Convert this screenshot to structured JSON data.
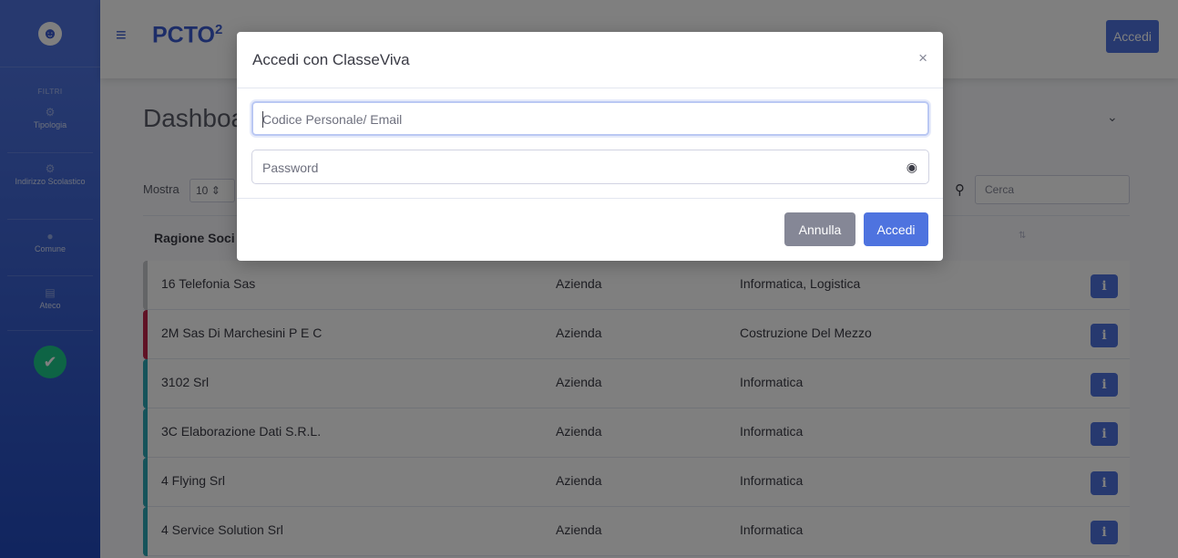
{
  "sidebar": {
    "brand_icon": "winking-face",
    "heading": "FILTRI",
    "items": [
      {
        "label": "Tipologia",
        "icon": "gear-icon"
      },
      {
        "label": "Indirizzo Scolastico",
        "icon": "gear-icon"
      },
      {
        "label": "Comune",
        "icon": "map-marker-icon"
      },
      {
        "label": "Ateco",
        "icon": "id-card-icon"
      }
    ],
    "apply_icon": "check-icon"
  },
  "topbar": {
    "menu_icon": "hamburger-icon",
    "logo_text": "PCTO",
    "logo_sup": "2",
    "login_button": "Accedi"
  },
  "main": {
    "title": "Dashboa",
    "show_label": "Mostra",
    "show_value": "10",
    "search_placeholder": "Cerca",
    "column_header": "Ragione Soci",
    "rows": [
      {
        "name": "16 Telefonia Sas",
        "type": "Azienda",
        "sector": "Informatica, Logistica",
        "color": "#c7c8cc"
      },
      {
        "name": "2M Sas Di Marchesini P E C",
        "type": "Azienda",
        "sector": "Costruzione Del Mezzo",
        "color": "#c0244a"
      },
      {
        "name": "3102 Srl",
        "type": "Azienda",
        "sector": "Informatica",
        "color": "#2ba7b5"
      },
      {
        "name": "3C Elaborazione Dati S.R.L.",
        "type": "Azienda",
        "sector": "Informatica",
        "color": "#2ba7b5"
      },
      {
        "name": "4 Flying Srl",
        "type": "Azienda",
        "sector": "Informatica",
        "color": "#2ba7b5"
      },
      {
        "name": "4 Service Solution Srl",
        "type": "Azienda",
        "sector": "Informatica",
        "color": "#2ba7b5"
      }
    ]
  },
  "modal": {
    "title": "Accedi con ClasseViva",
    "close": "×",
    "code_placeholder": "Codice Personale/ Email",
    "password_placeholder": "Password",
    "cancel": "Annulla",
    "submit": "Accedi"
  }
}
